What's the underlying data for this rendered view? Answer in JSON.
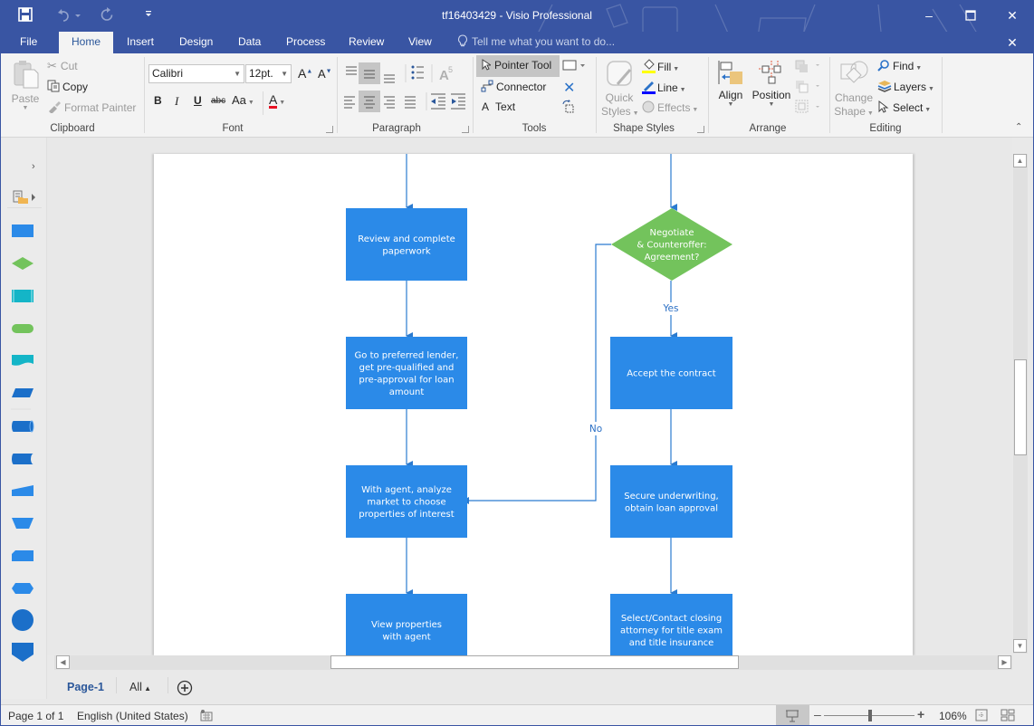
{
  "window": {
    "title": "tf16403429 - Visio Professional",
    "minimize": "–",
    "maximize": "☐",
    "close": "✕",
    "close_doc": "✕"
  },
  "qat": {
    "save_icon": "save-icon",
    "undo_icon": "undo-icon",
    "redo_icon": "redo-icon",
    "customize_icon": "customize-icon"
  },
  "tabs": [
    {
      "label": "File",
      "active": false
    },
    {
      "label": "Home",
      "active": true
    },
    {
      "label": "Insert",
      "active": false
    },
    {
      "label": "Design",
      "active": false
    },
    {
      "label": "Data",
      "active": false
    },
    {
      "label": "Process",
      "active": false
    },
    {
      "label": "Review",
      "active": false
    },
    {
      "label": "View",
      "active": false
    }
  ],
  "tell_me": {
    "placeholder": "Tell me what you want to do..."
  },
  "ribbon": {
    "clipboard": {
      "label": "Clipboard",
      "paste": "Paste",
      "cut": "Cut",
      "copy": "Copy",
      "format_painter": "Format Painter"
    },
    "font": {
      "label": "Font",
      "font_name": "Calibri",
      "font_size": "12pt.",
      "grow": "A",
      "shrink": "A",
      "bold": "B",
      "italic": "I",
      "underline": "U",
      "strikethrough": "abc",
      "change_case": "Aa",
      "font_color": "A",
      "font_color_hex": "#e81123"
    },
    "paragraph": {
      "label": "Paragraph"
    },
    "tools": {
      "label": "Tools",
      "pointer": "Pointer Tool",
      "connector": "Connector",
      "text": "Text"
    },
    "shape_styles": {
      "label": "Shape Styles",
      "quick_styles_1": "Quick",
      "quick_styles_2": "Styles",
      "fill": "Fill",
      "line": "Line",
      "effects": "Effects",
      "fill_color_hex": "#ffff00",
      "line_color_hex": "#0000ff"
    },
    "arrange": {
      "label": "Arrange",
      "align": "Align",
      "position": "Position"
    },
    "editing": {
      "label": "Editing",
      "change_shape_1": "Change",
      "change_shape_2": "Shape",
      "find": "Find",
      "layers": "Layers",
      "select": "Select"
    }
  },
  "diagram": {
    "colors": {
      "process": "#2b8ae8",
      "decision": "#73c35c",
      "connector": "#2b7bd0"
    },
    "nodes": [
      {
        "id": "review",
        "type": "process",
        "lines": [
          "Review and complete",
          "paperwork"
        ]
      },
      {
        "id": "lender",
        "type": "process",
        "lines": [
          "Go to preferred lender,",
          "get pre-qualified and",
          "pre-approval for loan",
          "amount"
        ]
      },
      {
        "id": "analyze",
        "type": "process",
        "lines": [
          "With agent, analyze",
          "market to choose",
          "properties of interest"
        ]
      },
      {
        "id": "view",
        "type": "process",
        "lines": [
          "View properties",
          "with agent"
        ]
      },
      {
        "id": "negotiate",
        "type": "decision",
        "lines": [
          "Negotiate",
          "& Counteroffer:",
          "Agreement?"
        ]
      },
      {
        "id": "accept",
        "type": "process",
        "lines": [
          "Accept the contract"
        ]
      },
      {
        "id": "underwrite",
        "type": "process",
        "lines": [
          "Secure underwriting,",
          "obtain loan approval"
        ]
      },
      {
        "id": "attorney",
        "type": "process",
        "lines": [
          "Select/Contact closing",
          "attorney for title exam",
          "and title insurance"
        ]
      }
    ],
    "labels": {
      "yes": "Yes",
      "no": "No"
    }
  },
  "page_tabs": {
    "current": "Page-1",
    "all": "All",
    "add_icon": "add-page-icon"
  },
  "status": {
    "page": "Page 1 of 1",
    "language": "English (United States)",
    "zoom": "106%",
    "zoom_level_percent": 106
  }
}
